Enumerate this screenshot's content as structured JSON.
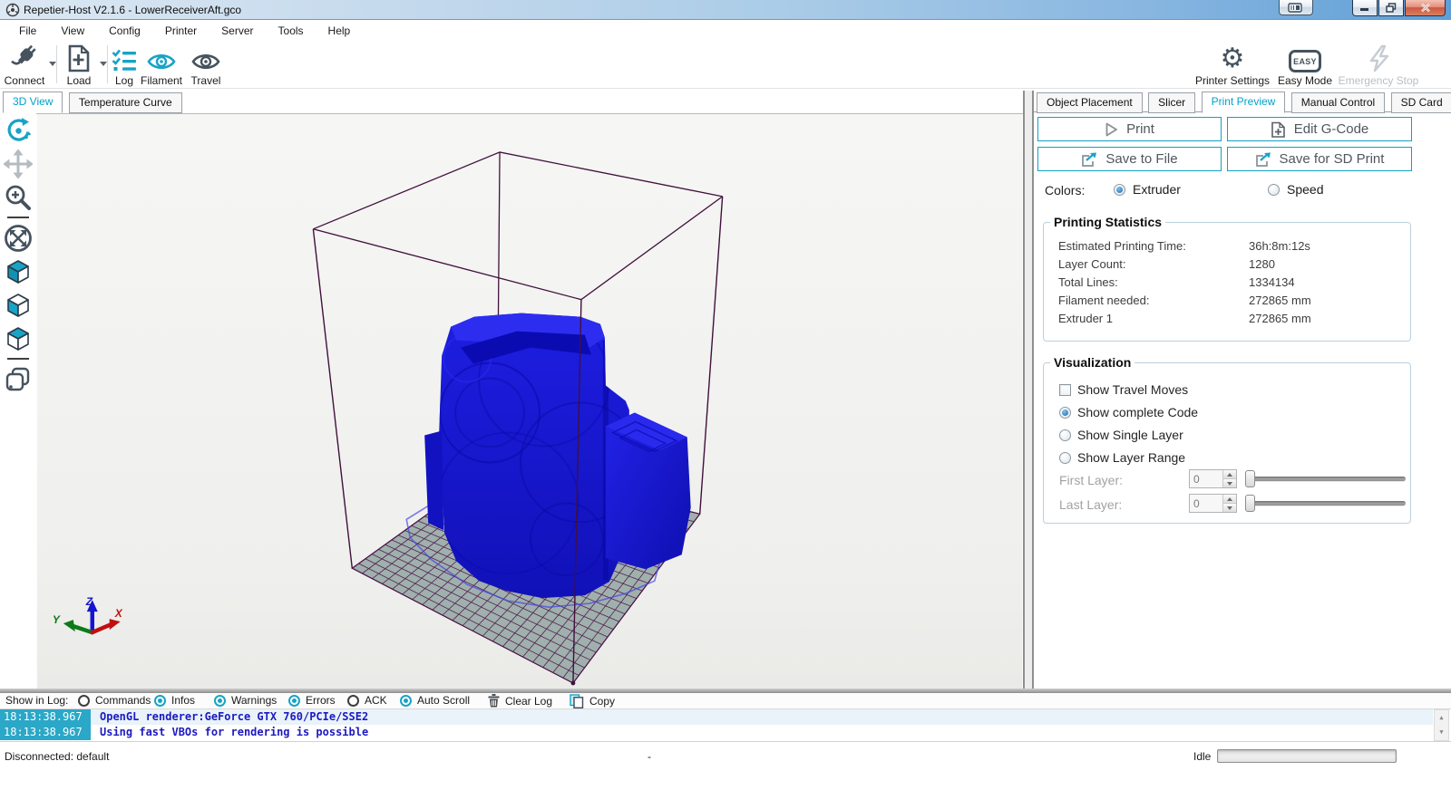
{
  "window": {
    "title": "Repetier-Host V2.1.6 - LowerReceiverAft.gco"
  },
  "menu": {
    "items": [
      "File",
      "View",
      "Config",
      "Printer",
      "Server",
      "Tools",
      "Help"
    ]
  },
  "toolbar": {
    "connect": "Connect",
    "load": "Load",
    "log": "Log",
    "filament": "Filament",
    "travel": "Travel",
    "printer_settings": "Printer Settings",
    "easy_mode": "Easy Mode",
    "easy_badge": "EASY",
    "emergency_stop": "Emergency Stop"
  },
  "left_tabs": {
    "view3d": "3D View",
    "temperature": "Temperature Curve"
  },
  "right_tabs": {
    "items": [
      "Object Placement",
      "Slicer",
      "Print Preview",
      "Manual Control",
      "SD Card"
    ],
    "active": "Print Preview"
  },
  "preview": {
    "print": "Print",
    "edit_gcode": "Edit G-Code",
    "save_to_file": "Save to File",
    "save_for_sd": "Save for SD Print",
    "colors_label": "Colors:",
    "extruder": "Extruder",
    "speed": "Speed"
  },
  "stats": {
    "title": "Printing Statistics",
    "rows": [
      {
        "label": "Estimated Printing Time:",
        "value": "36h:8m:12s"
      },
      {
        "label": "Layer Count:",
        "value": "1280"
      },
      {
        "label": "Total Lines:",
        "value": "1334134"
      },
      {
        "label": "Filament needed:",
        "value": "272865 mm"
      },
      {
        "label": "Extruder 1",
        "value": "272865 mm"
      }
    ]
  },
  "visualization": {
    "title": "Visualization",
    "show_travel": "Show Travel Moves",
    "show_complete": "Show complete Code",
    "show_single": "Show Single Layer",
    "show_range": "Show Layer Range",
    "first_layer_label": "First Layer:",
    "last_layer_label": "Last Layer:",
    "first_layer_value": "0",
    "last_layer_value": "0"
  },
  "viewport": {
    "axis": {
      "x": "X",
      "y": "Y",
      "z": "Z"
    }
  },
  "log": {
    "show_label": "Show in Log:",
    "toggles": [
      {
        "label": "Commands",
        "on": false
      },
      {
        "label": "Infos",
        "on": true
      },
      {
        "label": "Warnings",
        "on": true
      },
      {
        "label": "Errors",
        "on": true
      },
      {
        "label": "ACK",
        "on": false
      },
      {
        "label": "Auto Scroll",
        "on": true
      }
    ],
    "clear": "Clear Log",
    "copy": "Copy",
    "entries": [
      {
        "time": "18:13:38.967",
        "text": "OpenGL renderer:GeForce GTX 760/PCIe/SSE2"
      },
      {
        "time": "18:13:38.967",
        "text": "Using fast VBOs for rendering is possible"
      }
    ]
  },
  "status": {
    "connection": "Disconnected: default",
    "center": "-",
    "idle_label": "Idle"
  },
  "theme": {
    "accent": "#18a3c7",
    "tab_active": "#00a2c8",
    "object_blue": "#1a1ad6",
    "object_top": "#2d2df0",
    "bed_fill": "#9fb0ad",
    "bed_line": "#4a1045",
    "frame_line": "#40103c",
    "log_text": "#1c1abf",
    "log_time_bg": "#2ba7c7",
    "close_red": "#cb5740"
  }
}
